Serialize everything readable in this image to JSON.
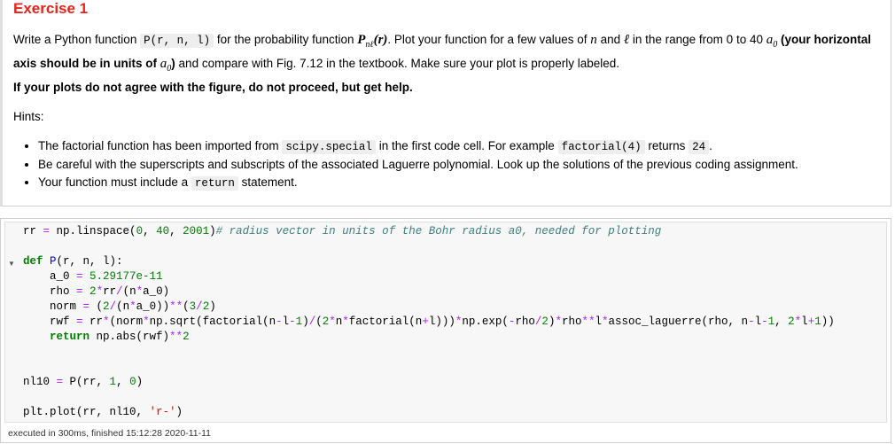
{
  "markdown": {
    "title": "Exercise 1",
    "intro_1": "Write a Python function",
    "func_code": "P(r, n, l)",
    "intro_2": "for the probability function",
    "math_P": "P",
    "math_sub": "nℓ",
    "math_arg": "(r)",
    "intro_3": ". Plot your function for a few values of",
    "math_n": "n",
    "intro_and": "and",
    "math_l": "ℓ",
    "intro_4": "in the range from 0 to 40",
    "math_a": "a",
    "math_a_sub": "0",
    "intro_bold_1": "(your horizontal axis should be in units of",
    "intro_bold_2": ")",
    "intro_5": "and compare with Fig. 7.12 in the textbook. Make sure your plot is properly labeled.",
    "warning": "If your plots do not agree with the figure, do not proceed, but get help.",
    "hints_label": "Hints:",
    "hint1_a": "The factorial function has been imported from",
    "hint1_code1": "scipy.special",
    "hint1_b": "in the first code cell. For example",
    "hint1_code2": "factorial(4)",
    "hint1_c": "returns",
    "hint1_code3": "24",
    "hint1_d": ".",
    "hint2": "Be careful with the superscripts and subscripts of the associated Laguerre polynomial. Look up the solutions of the previous coding assignment.",
    "hint3_a": "Your function must include a",
    "hint3_code": "return",
    "hint3_b": "statement."
  },
  "code_cell": {
    "status": "executed in 300ms, finished 15:12:28 2020-11-11"
  }
}
